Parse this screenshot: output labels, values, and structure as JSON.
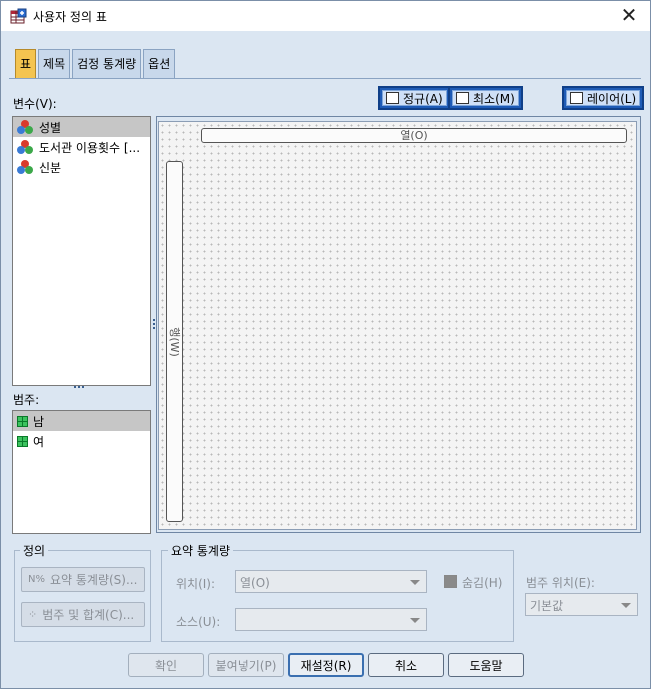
{
  "window": {
    "title": "사용자 정의 표",
    "close_glyph": "✕"
  },
  "tabs": [
    {
      "label": "표",
      "active": true
    },
    {
      "label": "제목",
      "active": false
    },
    {
      "label": "검정 통계량",
      "active": false
    },
    {
      "label": "옵션",
      "active": false
    }
  ],
  "variables": {
    "label": "변수(V):",
    "items": [
      {
        "label": "성별",
        "selected": true
      },
      {
        "label": "도서관 이용횟수 [...",
        "selected": false
      },
      {
        "label": "신분",
        "selected": false
      }
    ]
  },
  "categories": {
    "label": "범주:",
    "items": [
      {
        "label": "남",
        "selected": true
      },
      {
        "label": "여",
        "selected": false
      }
    ]
  },
  "toolbar": {
    "normal_label": "정규(A)",
    "compact_label": "최소(M)",
    "layer_label": "레이어(L)"
  },
  "canvas": {
    "column_label": "열(O)",
    "row_label": "행(W)"
  },
  "definition": {
    "title": "정의",
    "summary_button": "요약 통계량(S)...",
    "summary_icon_text": "N%",
    "category_button": "범주 및 합계(C)..."
  },
  "summary_stats": {
    "title": "요약 통계량",
    "position_label": "위치(I):",
    "position_value": "열(O)",
    "hide_label": "숨김(H)",
    "source_label": "소스(U):",
    "source_value": ""
  },
  "category_position": {
    "label": "범주 위치(E):",
    "value": "기본값"
  },
  "buttons": {
    "ok": "확인",
    "paste": "붙여넣기(P)",
    "reset": "재설정(R)",
    "cancel": "취소",
    "help": "도움말"
  },
  "colors": {
    "active_tab": "#f4c450",
    "toolbar_button": "#1e5bb6",
    "category_icon": "#3cc35f"
  }
}
